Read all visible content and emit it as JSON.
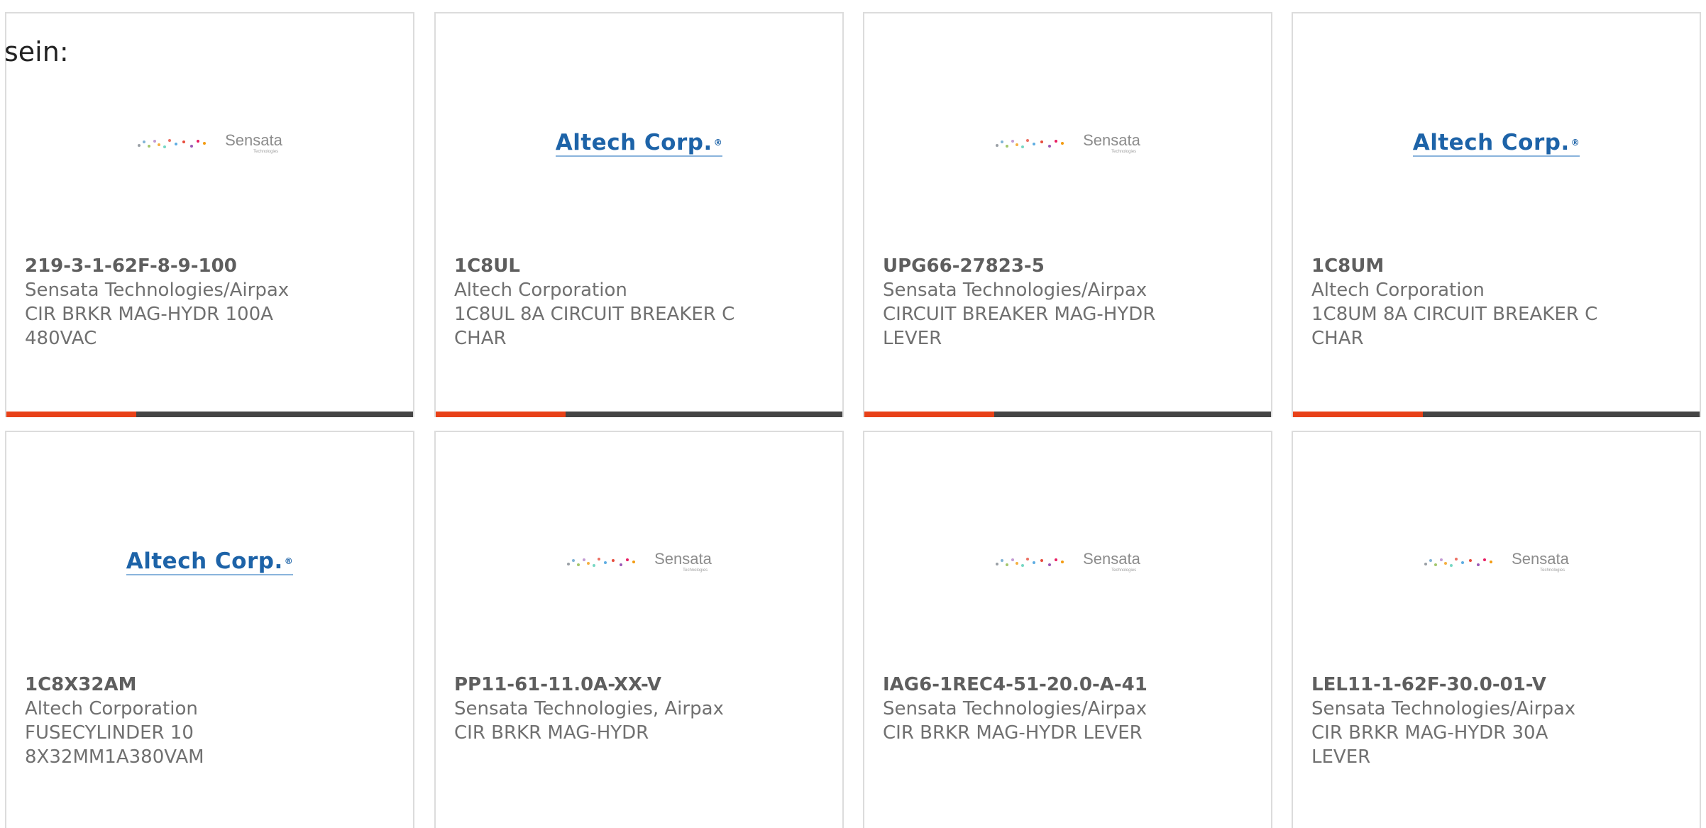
{
  "intro_text": "sein:",
  "colors": {
    "accent": "#e84118",
    "bar_track": "#454545",
    "altech_blue": "#1d63a8",
    "sensata_gray": "#8c8c8c"
  },
  "products": [
    {
      "logo": "sensata",
      "logo_text": "Sensata",
      "logo_subtext": "Technologies",
      "part_number": "219-3-1-62F-8-9-100",
      "manufacturer": "Sensata Technologies/Airpax",
      "description": "CIR BRKR MAG-HYDR 100A 480VAC",
      "progress": 0.32
    },
    {
      "logo": "altech",
      "logo_text": "Altech Corp.",
      "part_number": "1C8UL",
      "manufacturer": "Altech Corporation",
      "description": "1C8UL 8A CIRCUIT BREAKER C CHAR",
      "progress": 0.32
    },
    {
      "logo": "sensata",
      "logo_text": "Sensata",
      "logo_subtext": "Technologies",
      "part_number": "UPG66-27823-5",
      "manufacturer": "Sensata Technologies/Airpax",
      "description": "CIRCUIT BREAKER MAG-HYDR LEVER",
      "progress": 0.32
    },
    {
      "logo": "altech",
      "logo_text": "Altech Corp.",
      "part_number": "1C8UM",
      "manufacturer": "Altech Corporation",
      "description": "1C8UM 8A CIRCUIT BREAKER C CHAR",
      "progress": 0.32
    },
    {
      "logo": "altech",
      "logo_text": "Altech Corp.",
      "part_number": "1C8X32AM",
      "manufacturer": "Altech Corporation",
      "description": "FUSECYLINDER 10 8X32MM1A380VAM"
    },
    {
      "logo": "sensata",
      "logo_text": "Sensata",
      "logo_subtext": "Technologies",
      "part_number": "PP11-61-11.0A-XX-V",
      "manufacturer": "Sensata Technologies, Airpax",
      "description": "CIR BRKR MAG-HYDR"
    },
    {
      "logo": "sensata",
      "logo_text": "Sensata",
      "logo_subtext": "Technologies",
      "part_number": "IAG6-1REC4-51-20.0-A-41",
      "manufacturer": "Sensata Technologies/Airpax",
      "description": "CIR BRKR MAG-HYDR LEVER"
    },
    {
      "logo": "sensata",
      "logo_text": "Sensata",
      "logo_subtext": "Technologies",
      "part_number": "LEL11-1-62F-30.0-01-V",
      "manufacturer": "Sensata Technologies/Airpax",
      "description": "CIR BRKR MAG-HYDR 30A LEVER"
    }
  ]
}
